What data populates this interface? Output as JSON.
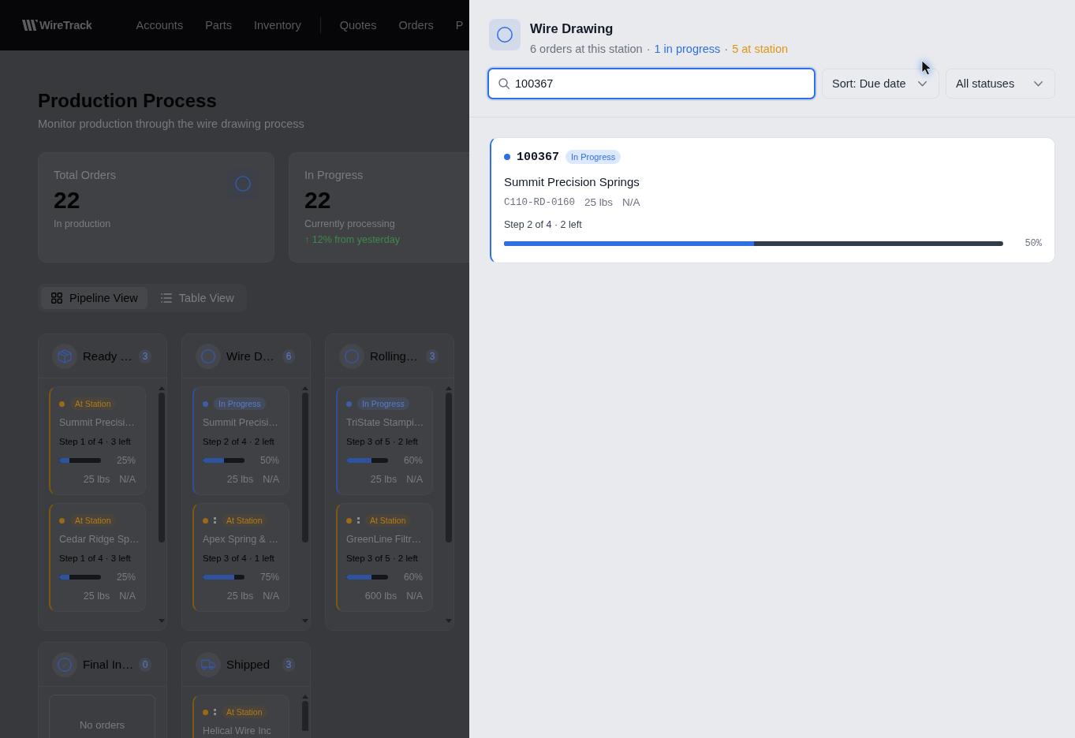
{
  "nav": {
    "logo": "WireTrack",
    "groups": [
      [
        {
          "label": "Accounts"
        },
        {
          "label": "Parts"
        },
        {
          "label": "Inventory"
        }
      ],
      [
        {
          "label": "Quotes"
        },
        {
          "label": "Orders"
        },
        {
          "label": "P"
        }
      ]
    ]
  },
  "header": {
    "title": "Production Process",
    "subtitle": "Monitor production through the wire drawing process"
  },
  "stats": [
    {
      "label": "Total Orders",
      "value": "22",
      "note": "In production"
    },
    {
      "label": "In Progress",
      "value": "22",
      "note": "Currently processing",
      "trend": "↑ 12% from yesterday"
    }
  ],
  "view_toggle": [
    {
      "label": "Pipeline View",
      "selected": true
    },
    {
      "label": "Table View",
      "selected": false
    }
  ],
  "columns": [
    {
      "title": "Ready …",
      "count": "3",
      "orders": [
        {
          "status": "At Station",
          "kind": "station",
          "mark": false,
          "name": "Summit Precisi…",
          "step": "Step 1 of 4 · 3 left",
          "level": 0.25,
          "percent": "25%",
          "weight": "25 lbs",
          "extra": "N/A"
        },
        {
          "status": "At Station",
          "kind": "station",
          "mark": false,
          "name": "Cedar Ridge Sp…",
          "step": "Step 1 of 4 · 3 left",
          "level": 0.25,
          "percent": "25%",
          "weight": "25 lbs",
          "extra": "N/A"
        }
      ]
    },
    {
      "title": "Wire D…",
      "count": "6",
      "orders": [
        {
          "status": "In Progress",
          "kind": "progress",
          "mark": false,
          "name": "Summit Precisi…",
          "step": "Step 2 of 4 · 2 left",
          "level": 0.5,
          "percent": "50%",
          "weight": "25 lbs",
          "extra": "N/A"
        },
        {
          "status": "At Station",
          "kind": "station",
          "mark": true,
          "name": "Apex Spring & …",
          "step": "Step 3 of 4 · 1 left",
          "level": 0.75,
          "percent": "75%",
          "weight": "25 lbs",
          "extra": "N/A"
        }
      ]
    },
    {
      "title": "Rolling…",
      "count": "3",
      "orders": [
        {
          "status": "In Progress",
          "kind": "progress",
          "mark": false,
          "name": "TriState Stampi…",
          "step": "Step 3 of 5 · 2 left",
          "level": 0.6,
          "percent": "60%",
          "weight": "25 lbs",
          "extra": "N/A"
        },
        {
          "status": "At Station",
          "kind": "station",
          "mark": true,
          "name": "GreenLine Filtr…",
          "step": "Step 3 of 5 · 2 left",
          "level": 0.6,
          "percent": "60%",
          "weight": "600 lbs",
          "extra": "N/A"
        }
      ]
    },
    {
      "title": "Final In…",
      "count": "0",
      "empty": "No orders"
    },
    {
      "title": "Shipped",
      "count": "3",
      "orders": [
        {
          "status": "At Station",
          "kind": "station",
          "mark": true,
          "name": "Helical Wire Inc"
        }
      ]
    }
  ],
  "panel": {
    "title": "Wire Drawing",
    "separator": "·",
    "summary": [
      {
        "text": "6 orders at this station",
        "kind": "total"
      },
      {
        "text": "1 in progress",
        "kind": "progress"
      },
      {
        "text": "5 at station",
        "kind": "station"
      }
    ],
    "search": {
      "value": "100367"
    },
    "filters": [
      {
        "label": "Sort: Due date"
      },
      {
        "label": "All statuses"
      }
    ],
    "orders": [
      {
        "number": "100367",
        "status": "In Progress",
        "kind": "progress",
        "customer": "Summit Precision Springs",
        "part": "C110-RD-0160",
        "weight": "25 lbs",
        "extra": "N/A",
        "step": "Step 2 of 4 · 2 left",
        "level": 0.5,
        "percent": "50%"
      }
    ]
  }
}
